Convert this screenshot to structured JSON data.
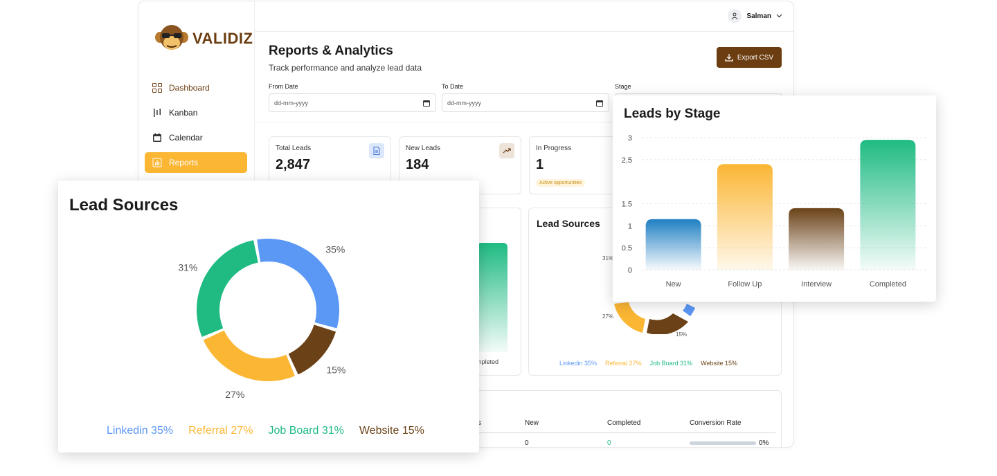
{
  "brand": {
    "name": "VALIDIZ"
  },
  "sidebar": {
    "items": [
      {
        "label": "Dashboard",
        "icon": "grid-icon"
      },
      {
        "label": "Kanban",
        "icon": "kanban-icon"
      },
      {
        "label": "Calendar",
        "icon": "calendar-icon"
      },
      {
        "label": "Reports",
        "icon": "chart-icon"
      }
    ]
  },
  "header": {
    "user": "Salman"
  },
  "page": {
    "title": "Reports & Analytics",
    "subtitle": "Track performance and analyze lead data",
    "export_label": "Export CSV"
  },
  "filters": {
    "from_label": "From Date",
    "from_placeholder": "dd-mm-yyyy",
    "to_label": "To Date",
    "to_placeholder": "dd-mm-yyyy",
    "stage_label": "Stage"
  },
  "stats": [
    {
      "label": "Total Leads",
      "value": "2,847"
    },
    {
      "label": "New Leads",
      "value": "184"
    },
    {
      "label": "In Progress",
      "value": "1",
      "badge": "Active opportunities"
    }
  ],
  "lead_sources_small": {
    "title": "Lead Sources",
    "label_31": "31%",
    "label_27": "27%",
    "label_15": "15%"
  },
  "small_bar_label": "mpleted",
  "table": {
    "headers": [
      "s",
      "New",
      "Completed",
      "Conversion Rate"
    ],
    "row": {
      "new": "0",
      "completed": "0",
      "rate": "0%"
    }
  },
  "colors": {
    "linkedin": "#5b97f5",
    "referral": "#fbb634",
    "job_board": "#1fbb83",
    "website": "#6b4218",
    "brand": "#6b3d10"
  },
  "chart_data": [
    {
      "type": "pie",
      "title": "Lead Sources",
      "categories": [
        "Linkedin",
        "Referral",
        "Job Board",
        "Website"
      ],
      "values": [
        35,
        27,
        31,
        15
      ],
      "labels": [
        "35%",
        "27%",
        "31%",
        "15%"
      ],
      "legend": [
        "Linkedin 35%",
        "Referral 27%",
        "Job Board 31%",
        "Website 15%"
      ],
      "legend_position": "bottom"
    },
    {
      "type": "bar",
      "title": "Leads by Stage",
      "categories": [
        "New",
        "Follow Up",
        "Interview",
        "Completed"
      ],
      "values": [
        1.15,
        2.4,
        1.4,
        2.95
      ],
      "ylim": [
        0,
        3
      ],
      "yticks": [
        "0",
        "0.5",
        "1",
        "1.5",
        "2.5",
        "3"
      ],
      "grid": true
    }
  ]
}
